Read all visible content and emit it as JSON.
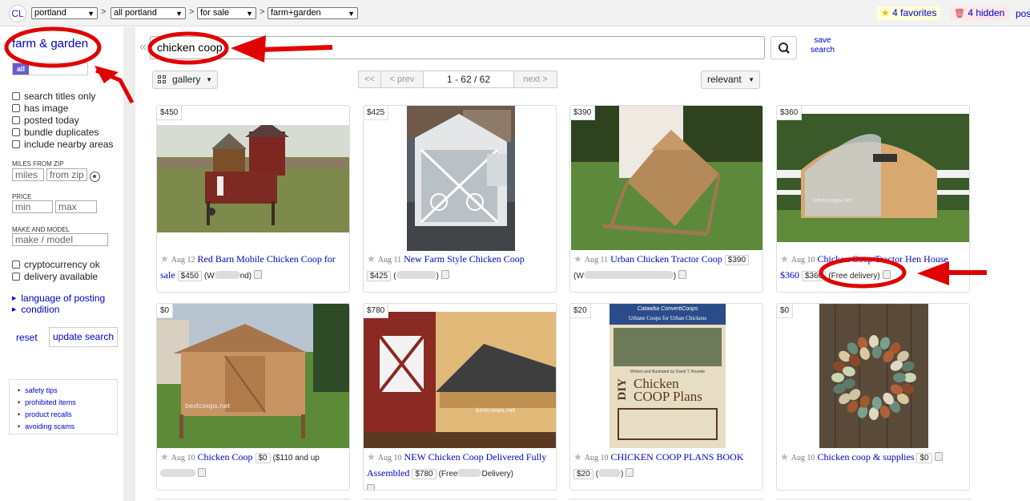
{
  "header": {
    "logo": "CL",
    "crumbs": [
      "portland",
      "all portland",
      "for sale",
      "farm+garden"
    ],
    "favorites": "4 favorites",
    "hidden": "4 hidden",
    "post": "pos"
  },
  "sidebar": {
    "category": "farm & garden",
    "tab_all": "all",
    "checkboxes": [
      "search titles only",
      "has image",
      "posted today",
      "bundle duplicates",
      "include nearby areas"
    ],
    "miles_label": "MILES FROM ZIP",
    "miles_placeholder": "miles",
    "zip_placeholder": "from zip",
    "price_label": "PRICE",
    "min_placeholder": "min",
    "max_placeholder": "max",
    "make_label": "MAKE AND MODEL",
    "make_placeholder": "make / model",
    "checkboxes2": [
      "cryptocurrency ok",
      "delivery available"
    ],
    "expanders": [
      "language of posting",
      "condition"
    ],
    "reset": "reset",
    "update": "update search",
    "tips": [
      "safety tips",
      "prohibited items",
      "product recalls",
      "avoiding scams"
    ]
  },
  "search": {
    "value": "chicken coop",
    "save_line1": "save",
    "save_line2": "search"
  },
  "toolbar": {
    "view": "gallery",
    "first": "<<",
    "prev": "< prev",
    "range": "1 - 62 / 62",
    "next": "next >",
    "sort": "relevant"
  },
  "listings": [
    {
      "price": "$450",
      "date": "Aug 12",
      "title": "Red Barn Mobile Chicken Coop for sale",
      "badge": "$450",
      "loc": "(W",
      "loc2": "nd)"
    },
    {
      "price": "$425",
      "date": "Aug 11",
      "title": "New Farm Style Chicken Coop",
      "badge": "$425",
      "loc": "(",
      "loc2": ")"
    },
    {
      "price": "$390",
      "date": "Aug 11",
      "title": "Urban Chicken Tractor Coop",
      "badge": "$390",
      "loc": "(W",
      "loc2": ")"
    },
    {
      "price": "$360",
      "date": "Aug 10",
      "title": "Chicken Coop Tractor Hen House",
      "badge": "$360",
      "title_prefix": "$360",
      "loc": "(Free delivery)"
    },
    {
      "price": "$0",
      "date": "Aug 10",
      "title": "Chicken Coop",
      "badge": "$0",
      "loc": "($110 and up"
    },
    {
      "price": "$780",
      "date": "Aug 10",
      "title": "NEW Chicken Coop Delivered Fully Assembled",
      "badge": "$780",
      "loc": "(Free",
      "loc2": "Delivery)"
    },
    {
      "price": "$20",
      "date": "Aug 10",
      "title": "CHICKEN COOP PLANS BOOK",
      "badge": "$20",
      "loc": "(",
      "loc2": ")"
    },
    {
      "price": "$0",
      "date": "Aug 10",
      "title": "Chicken coop & supplies",
      "badge": "$0"
    }
  ],
  "book": {
    "small_title": "Catawba ConvertiCoops",
    "subtitle": "Urbane Coops for Urban Chickens",
    "author": "Written and Illustrated by David T. Rosette",
    "title1": "DIY",
    "title2": "Chicken",
    "title3": "COOP Plans"
  },
  "watermarks": {
    "card4": "bestcoops.net",
    "card5": "bestcoops.net",
    "card6": "bestcoops.net"
  },
  "colors": {
    "link": "#0000cc",
    "annotation": "#e00000"
  }
}
